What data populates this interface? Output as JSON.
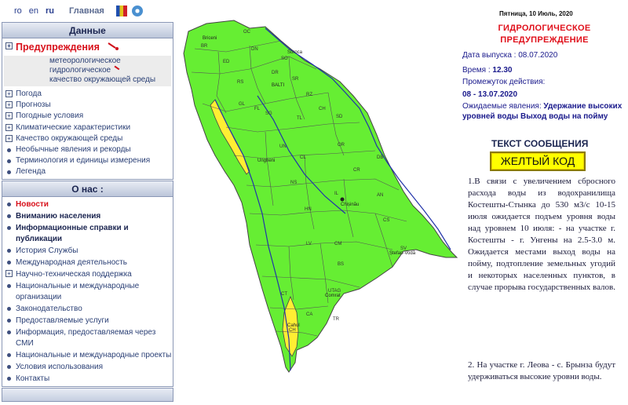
{
  "topbar": {
    "languages": [
      "ro",
      "en",
      "ru"
    ],
    "current_language": "ru",
    "home_label": "Главная"
  },
  "sidebar_data": {
    "title": "Данные",
    "warning_label": "Предупреждения",
    "warning_subitems": [
      "метеорологическое",
      "гидрологическое",
      "качество окружающей среды"
    ],
    "items": [
      {
        "label": "Погода",
        "icon": "plus-box-icon"
      },
      {
        "label": "Прогнозы",
        "icon": "plus-box-icon"
      },
      {
        "label": "Погодные условия",
        "icon": "plus-box-icon"
      },
      {
        "label": "Климатические характеристики",
        "icon": "plus-box-icon"
      },
      {
        "label": "Качество окружающей среды",
        "icon": "plus-box-icon"
      },
      {
        "label": "Необычные явления и рекорды",
        "icon": "bullet-icon"
      },
      {
        "label": "Терминология и единицы измерения",
        "icon": "bullet-icon"
      },
      {
        "label": "Легенда",
        "icon": "bullet-icon"
      }
    ]
  },
  "sidebar_about": {
    "title": "О нас :",
    "items": [
      {
        "label": "Новости",
        "style": "red"
      },
      {
        "label": "Вниманию населения",
        "style": "strong"
      },
      {
        "label": "Информационные справки и публикации",
        "style": "strong"
      },
      {
        "label": "История Службы",
        "style": "normal"
      },
      {
        "label": "Международная деятельность",
        "style": "normal"
      },
      {
        "label": "Научно-техническая поддержка",
        "style": "plus"
      },
      {
        "label": "Национальные и международные организации",
        "style": "normal"
      },
      {
        "label": "Законодательство",
        "style": "normal"
      },
      {
        "label": "Предоставляемые услуги",
        "style": "normal"
      },
      {
        "label": "Информация, предоставляемая через СМИ",
        "style": "normal"
      },
      {
        "label": "Национальные и международные проекты",
        "style": "normal"
      },
      {
        "label": "Условия использования",
        "style": "normal"
      },
      {
        "label": "Контакты",
        "style": "normal"
      }
    ]
  },
  "map": {
    "district_labels": [
      "OC",
      "BR",
      "ED",
      "DN",
      "SO",
      "DR",
      "RS",
      "SR",
      "FL",
      "GL",
      "SG",
      "RZ",
      "TL",
      "SD",
      "CH",
      "OR",
      "DB",
      "UN",
      "CL",
      "CR",
      "NS",
      "HN",
      "IL",
      "AN",
      "CS",
      "SV",
      "LV",
      "CM",
      "CT",
      "BS",
      "UTAG",
      "TR",
      "CH2",
      "CA"
    ],
    "city_labels": [
      "Briceni",
      "Soroca",
      "BALTI",
      "Ungheni",
      "Chișinău",
      "Ștefan-Vodă",
      "Comrat",
      "Cahul"
    ],
    "colors": {
      "green": "#66ee33",
      "yellow": "#ffee33",
      "border": "#5a5a5a",
      "river": "#2233aa"
    }
  },
  "warning": {
    "date": "Пятница, 10 Июль, 2020",
    "title": "ГИДРОЛОГИЧЕСКОЕ ПРЕДУПРЕЖДЕНИЕ",
    "issue_label": "Дата выпуска :",
    "issue_value": "08.07.2020",
    "time_label": "Время :",
    "time_value": "12.30",
    "period_label": "Промежуток действия:",
    "period_value": "08 - 13.07.2020",
    "expected_label": "Ожидаемые явления:",
    "expected_value": "Удержание высоких уровней воды Выход воды на пойму",
    "message_header": "ТЕКСТ СООБЩЕНИЯ",
    "level": "ЖЕЛТЫЙ КОД",
    "paragraph1": "1.В связи с увеличением сбросного расхода воды из водохранилища Костешты-Стынка до 530 м3/с 10-15 июля ожидается подъем уровня воды над уровнем 10 июля: - на участке г. Костешты - г. Унгены на 2.5-3.0 м. Ожидается местами выход воды на пойму, подтопление земельных угодий и некоторых населенных пунктов, в случае прорыва государственных валов.",
    "paragraph2": "2. На участке г. Леова - с. Брынза будут удерживаться высокие уровни воды."
  }
}
